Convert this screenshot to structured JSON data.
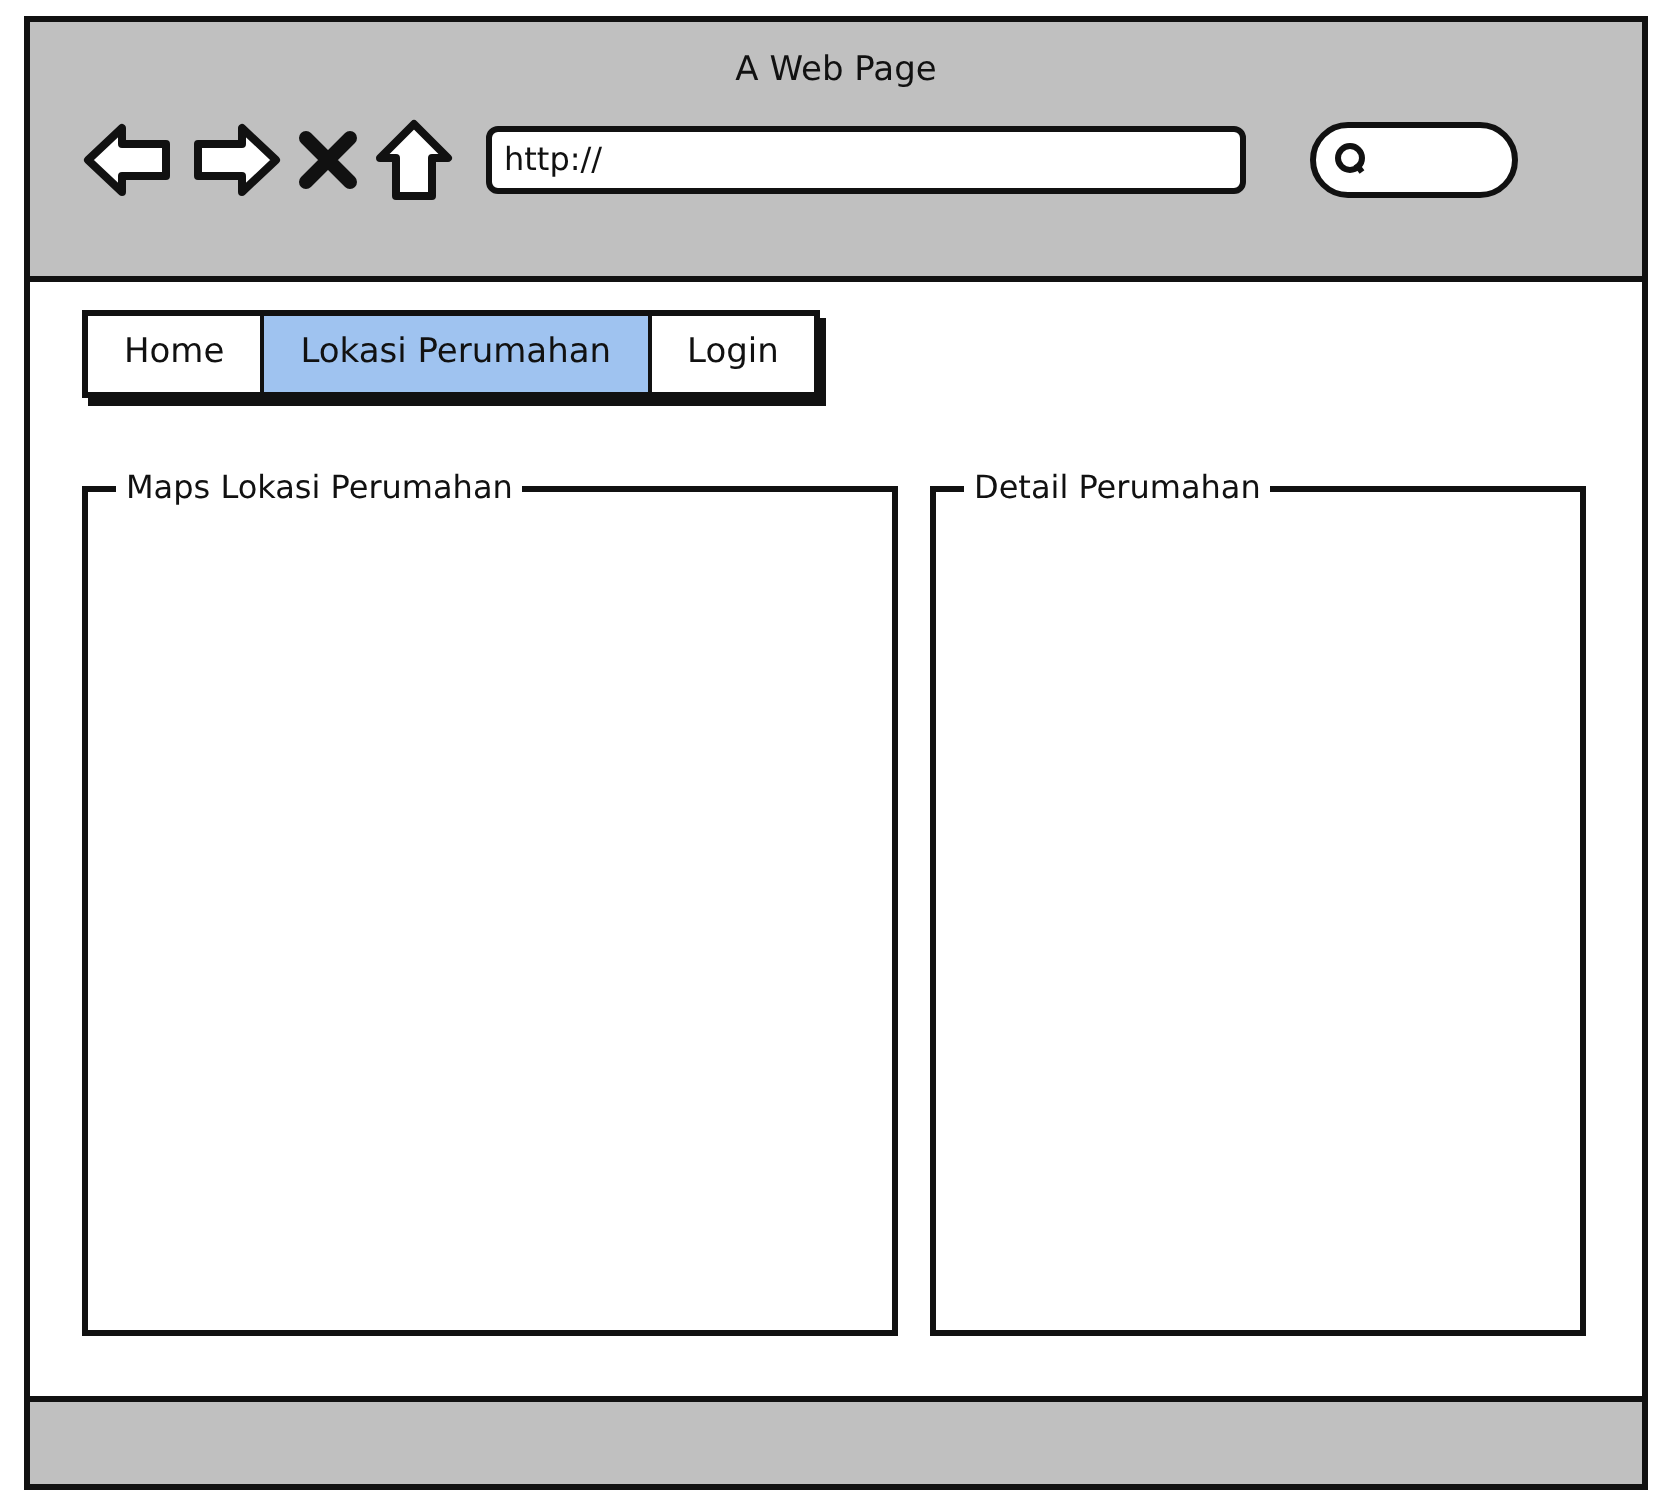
{
  "window": {
    "title": "A Web Page"
  },
  "address_bar": {
    "value": "http://"
  },
  "tabs": [
    {
      "label": "Home",
      "selected": false
    },
    {
      "label": "Lokasi Perumahan",
      "selected": true
    },
    {
      "label": "Login",
      "selected": false
    }
  ],
  "panels": [
    {
      "title": "Maps Lokasi Perumahan"
    },
    {
      "title": "Detail Perumahan"
    }
  ]
}
